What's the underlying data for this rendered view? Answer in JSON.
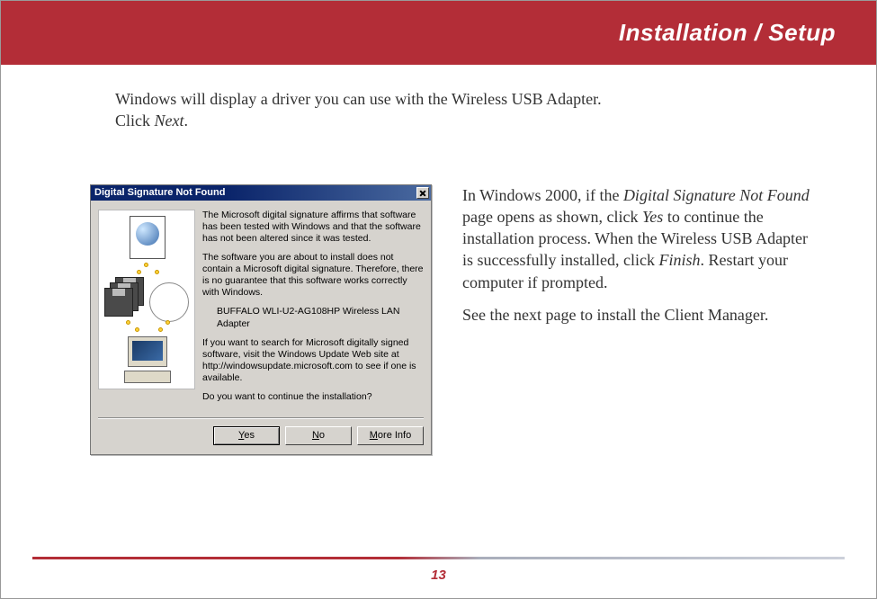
{
  "header": {
    "title": "Installation / Setup"
  },
  "intro": {
    "line1": "Windows will display a driver you can use with the Wireless USB Adapter.",
    "line2_pre": "Click ",
    "line2_em": "Next",
    "line2_post": "."
  },
  "dialog": {
    "title": "Digital Signature Not Found",
    "p1": "The Microsoft digital signature affirms that software has been tested with Windows and that the software has not been altered since it was tested.",
    "p2": "The software you are about to install does not contain a Microsoft digital signature. Therefore, there is no guarantee that this software works correctly with Windows.",
    "product": "BUFFALO WLI-U2-AG108HP Wireless LAN Adapter",
    "p3": "If you want to search for Microsoft digitally signed software, visit the Windows Update Web site at http://windowsupdate.microsoft.com to see if one is available.",
    "p4": "Do you want to continue the installation?",
    "buttons": {
      "yes": "Yes",
      "no": "No",
      "more": "More Info"
    }
  },
  "side": {
    "p1_pre": "In Windows 2000, if the ",
    "p1_em1": "Digital Signature Not Found",
    "p1_mid1": " page opens as shown, click ",
    "p1_em2": "Yes",
    "p1_mid2": " to continue the installation process. When the Wireless USB Adapter is successfully installed, click ",
    "p1_em3": "Finish",
    "p1_post": ". Restart your computer if prompted.",
    "p2": "See the next page to install the Client Manager."
  },
  "page_number": "13"
}
